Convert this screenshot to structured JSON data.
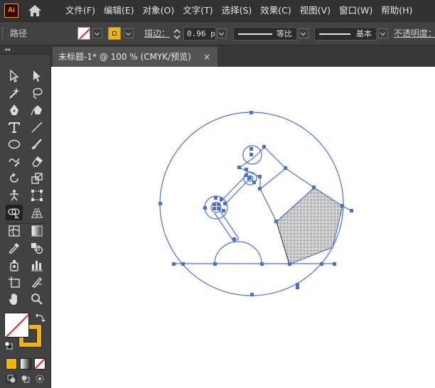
{
  "app": {
    "logo_text": "Ai"
  },
  "menu": [
    "文件(F)",
    "编辑(E)",
    "对象(O)",
    "文字(T)",
    "选择(S)",
    "效果(C)",
    "视图(V)",
    "窗口(W)",
    "帮助(H)"
  ],
  "control_bar": {
    "selection_type": "路径",
    "stroke_label": "描边：",
    "stroke_value": "0.96 p",
    "variable_width_profile": "等比",
    "brush_definition": "基本",
    "opacity_label": "不透明度："
  },
  "document_tab": {
    "title": "未标题-1* @ 100 % (CMYK/预览)",
    "close_glyph": "×"
  },
  "colors": {
    "menu_bg": "#323232",
    "panel_bg": "#424242",
    "workspace_bg": "#535353",
    "artboard": "#ffffff",
    "selection_blue": "#4a6fd6",
    "fill_swatch": "#f4b400"
  },
  "tools": [
    "selection-tool-icon",
    "direct-selection-tool-icon",
    "magic-wand-tool-icon",
    "lasso-tool-icon",
    "pen-tool-icon",
    "curvature-tool-icon",
    "type-tool-icon",
    "line-segment-tool-icon",
    "ellipse-tool-icon",
    "paintbrush-tool-icon",
    "shaper-tool-icon",
    "eraser-tool-icon",
    "rotate-tool-icon",
    "scale-tool-icon",
    "puppet-warp-tool-icon",
    "free-transform-tool-icon",
    "shape-builder-tool-icon",
    "perspective-grid-tool-icon",
    "mesh-tool-icon",
    "gradient-tool-icon",
    "eyedropper-tool-icon",
    "blend-tool-icon",
    "symbol-sprayer-tool-icon",
    "column-graph-tool-icon",
    "artboard-tool-icon",
    "slice-tool-icon",
    "hand-tool-icon",
    "zoom-tool-icon"
  ]
}
